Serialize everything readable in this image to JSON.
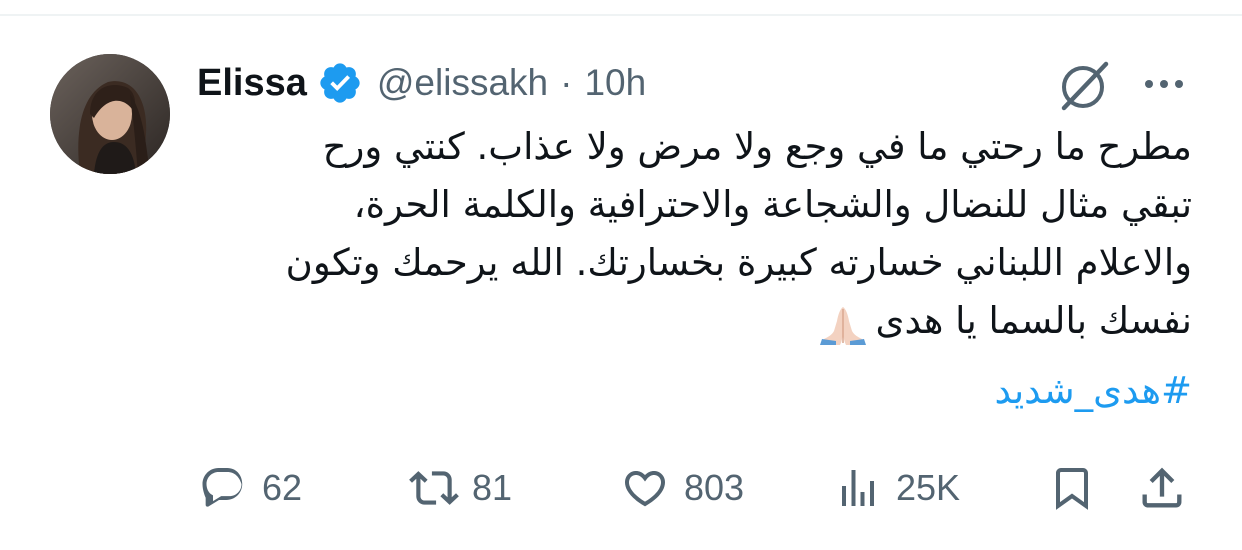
{
  "tweet": {
    "author": {
      "name": "Elissa",
      "handle": "@elissakh",
      "separator": "·",
      "time": "10h",
      "verified": true
    },
    "text_lines": [
      "مطرح ما رحتي ما في وجع ولا مرض ولا عذاب. كنتي ورح",
      "تبقي مثال للنضال والشجاعة والاحترافية والكلمة الحرة،",
      "والاعلام اللبناني خسارته كبيرة بخسارتك. الله يرحمك وتكون",
      "نفسك بالسما يا هدى"
    ],
    "emoji": "folded-hands",
    "hashtag": "#هدى_شديد"
  },
  "actions": {
    "replies": "62",
    "retweets": "81",
    "likes": "803",
    "views": "25K"
  },
  "icons": {
    "verified_badge": "verified-badge-icon",
    "grok": "grok-icon",
    "more": "more-icon",
    "reply": "reply-icon",
    "retweet": "retweet-icon",
    "like": "heart-icon",
    "views": "views-icon",
    "bookmark": "bookmark-icon",
    "share": "share-icon"
  },
  "colors": {
    "primary_text": "#0f1419",
    "secondary_text": "#536471",
    "link": "#1d9bf0",
    "verified": "#1d9bf0"
  }
}
